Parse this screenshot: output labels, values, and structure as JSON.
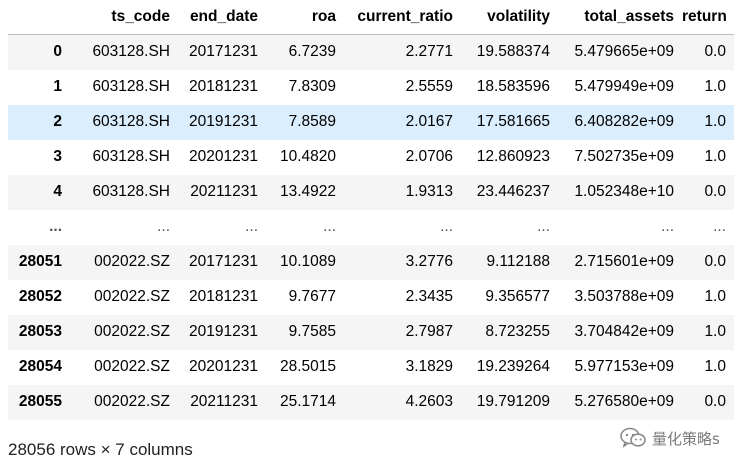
{
  "table": {
    "index_header": "",
    "columns": [
      "ts_code",
      "end_date",
      "roa",
      "current_ratio",
      "volatility",
      "total_assets",
      "return"
    ],
    "rows": [
      {
        "index": "0",
        "cells": [
          "603128.SH",
          "20171231",
          "6.7239",
          "2.2771",
          "19.588374",
          "5.479665e+09",
          "0.0"
        ]
      },
      {
        "index": "1",
        "cells": [
          "603128.SH",
          "20181231",
          "7.8309",
          "2.5559",
          "18.583596",
          "5.479949e+09",
          "1.0"
        ]
      },
      {
        "index": "2",
        "cells": [
          "603128.SH",
          "20191231",
          "7.8589",
          "2.0167",
          "17.581665",
          "6.408282e+09",
          "1.0"
        ]
      },
      {
        "index": "3",
        "cells": [
          "603128.SH",
          "20201231",
          "10.4820",
          "2.0706",
          "12.860923",
          "7.502735e+09",
          "1.0"
        ]
      },
      {
        "index": "4",
        "cells": [
          "603128.SH",
          "20211231",
          "13.4922",
          "1.9313",
          "23.446237",
          "1.052348e+10",
          "0.0"
        ]
      },
      {
        "index": "...",
        "cells": [
          "...",
          "...",
          "...",
          "...",
          "...",
          "...",
          "..."
        ]
      },
      {
        "index": "28051",
        "cells": [
          "002022.SZ",
          "20171231",
          "10.1089",
          "3.2776",
          "9.112188",
          "2.715601e+09",
          "0.0"
        ]
      },
      {
        "index": "28052",
        "cells": [
          "002022.SZ",
          "20181231",
          "9.7677",
          "2.3435",
          "9.356577",
          "3.503788e+09",
          "1.0"
        ]
      },
      {
        "index": "28053",
        "cells": [
          "002022.SZ",
          "20191231",
          "9.7585",
          "2.7987",
          "8.723255",
          "3.704842e+09",
          "1.0"
        ]
      },
      {
        "index": "28054",
        "cells": [
          "002022.SZ",
          "20201231",
          "28.5015",
          "3.1829",
          "19.239264",
          "5.977153e+09",
          "1.0"
        ]
      },
      {
        "index": "28055",
        "cells": [
          "002022.SZ",
          "20211231",
          "25.1714",
          "4.2603",
          "19.791209",
          "5.276580e+09",
          "0.0"
        ]
      }
    ],
    "hovered_row": 2
  },
  "shape_caption": "28056 rows × 7 columns",
  "watermark": {
    "icon": "wechat-icon",
    "text": "量化策略s"
  },
  "colors": {
    "hover_row": "#dbeefd",
    "striped_row": "#f5f5f5",
    "header_border": "#bdbdbd"
  }
}
